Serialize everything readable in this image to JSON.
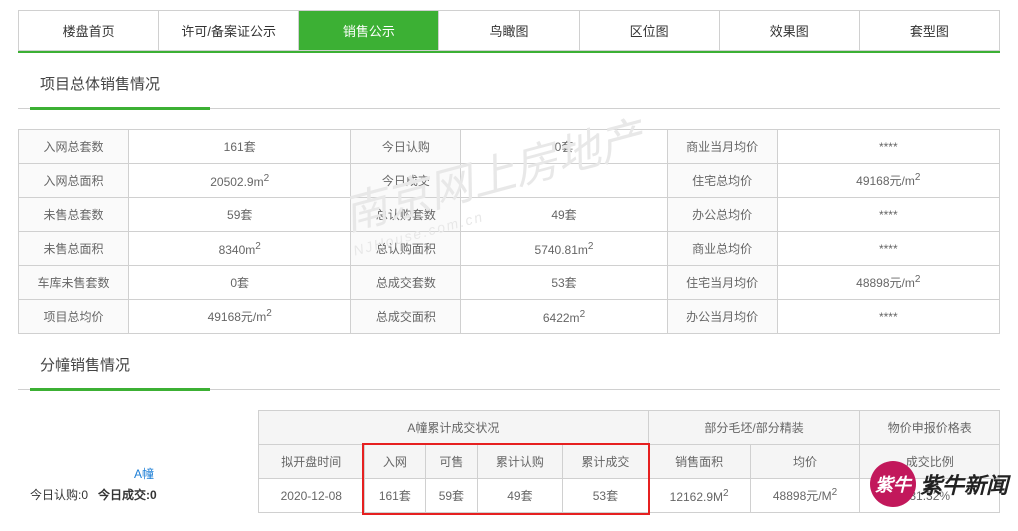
{
  "tabs": {
    "items": [
      "楼盘首页",
      "许可/备案证公示",
      "销售公示",
      "鸟瞰图",
      "区位图",
      "效果图",
      "套型图"
    ],
    "activeIndex": 2
  },
  "sections": {
    "overall_title": "项目总体销售情况",
    "building_title": "分幢销售情况"
  },
  "summary": {
    "rows": [
      {
        "l1": "入网总套数",
        "v1": "161套",
        "l2": "今日认购",
        "v2": "0套",
        "l3": "商业当月均价",
        "v3": "****"
      },
      {
        "l1": "入网总面积",
        "v1": "20502.9m²",
        "l2": "今日成交",
        "v2": "",
        "l3": "住宅总均价",
        "v3": "49168元/m²"
      },
      {
        "l1": "未售总套数",
        "v1": "59套",
        "l2": "总认购套数",
        "v2": "49套",
        "l3": "办公总均价",
        "v3": "****"
      },
      {
        "l1": "未售总面积",
        "v1": "8340m²",
        "l2": "总认购面积",
        "v2": "5740.81m²",
        "l3": "商业总均价",
        "v3": "****"
      },
      {
        "l1": "车库未售套数",
        "v1": "0套",
        "l2": "总成交套数",
        "v2": "53套",
        "l3": "住宅当月均价",
        "v3": "48898元/m²"
      },
      {
        "l1": "项目总均价",
        "v1": "49168元/m²",
        "l2": "总成交面积",
        "v2": "6422m²",
        "l3": "办公当月均价",
        "v3": "****"
      }
    ]
  },
  "building": {
    "name": "A幢",
    "today_sub_label": "今日认购:",
    "today_sub_value": "0",
    "today_deal_label": "今日成交:",
    "today_deal_value": "0",
    "header_status": "A幢累计成交状况",
    "header_decor": "部分毛坯/部分精装",
    "price_link": "物价申报价格表",
    "cols": [
      "拟开盘时间",
      "入网",
      "可售",
      "累计认购",
      "累计成交",
      "销售面积",
      "均价",
      "成交比例"
    ],
    "row": [
      "2020-12-08",
      "161套",
      "59套",
      "49套",
      "53套",
      "12162.9M²",
      "48898元/M²",
      "31.32%"
    ]
  },
  "watermark": {
    "main": "南京网上房地产",
    "sub": "NJHouse.com.cn"
  },
  "logo": {
    "circle": "紫牛",
    "text": "紫牛新闻"
  }
}
